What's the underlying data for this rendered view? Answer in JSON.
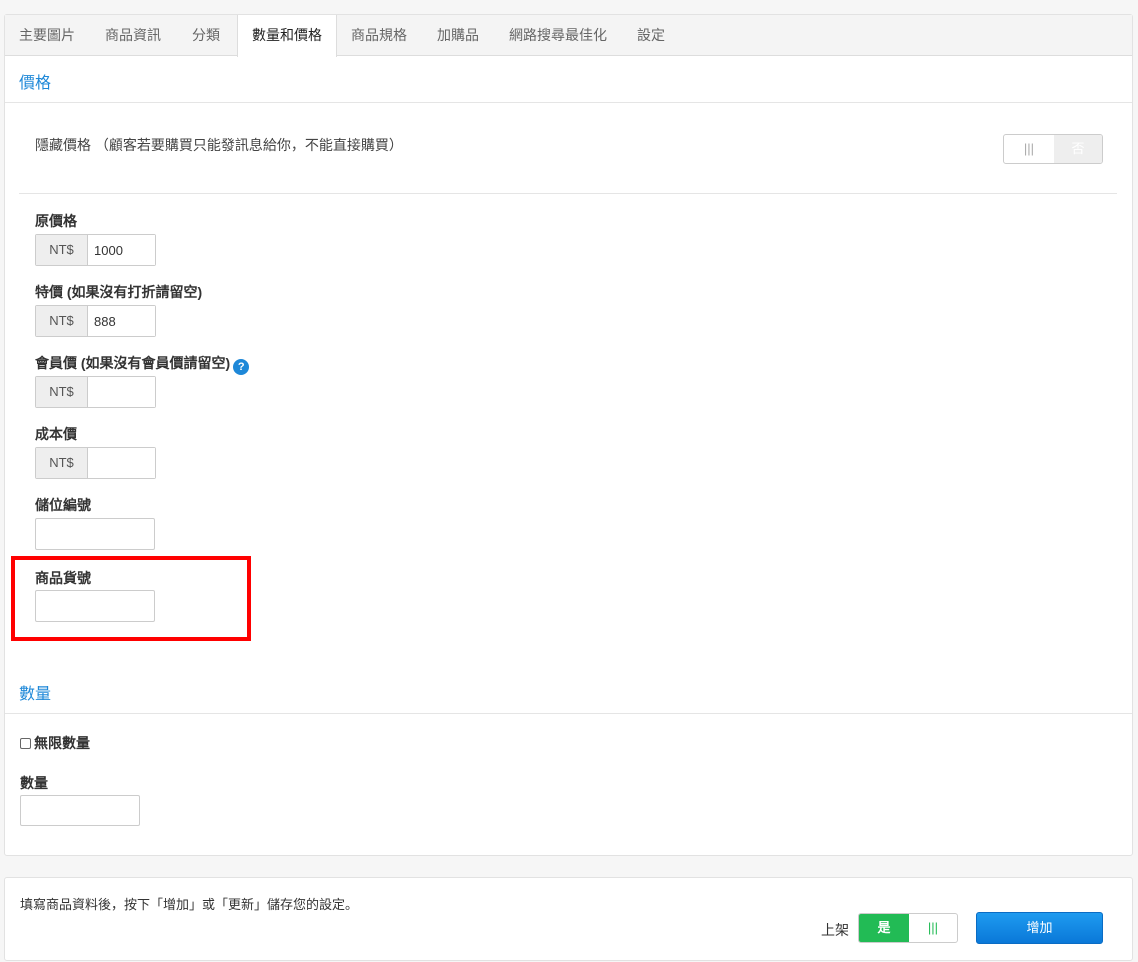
{
  "tabs": [
    {
      "label": "主要圖片"
    },
    {
      "label": "商品資訊"
    },
    {
      "label": "分類"
    },
    {
      "label": "數量和價格"
    },
    {
      "label": "商品規格"
    },
    {
      "label": "加購品"
    },
    {
      "label": "網路搜尋最佳化"
    },
    {
      "label": "設定"
    }
  ],
  "active_tab": "數量和價格",
  "price_section": {
    "title": "價格",
    "hide_price": {
      "label": "隱藏價格 （顧客若要購買只能發訊息給你，不能直接購買）",
      "toggle_on_icon": "|||",
      "toggle_off_label": "否"
    },
    "original_price": {
      "label": "原價格",
      "currency": "NT$",
      "value": "1000"
    },
    "special_price": {
      "label": "特價 (如果沒有打折請留空)",
      "currency": "NT$",
      "value": "888"
    },
    "member_price": {
      "label": "會員價 (如果沒有會員價請留空)",
      "currency": "NT$",
      "value": "",
      "help_icon": "question-circle-icon"
    },
    "cost_price": {
      "label": "成本價",
      "currency": "NT$",
      "value": ""
    },
    "storage_code": {
      "label": "儲位編號",
      "value": ""
    },
    "sku": {
      "label": "商品貨號",
      "value": ""
    }
  },
  "quantity_section": {
    "title": "數量",
    "unlimited_label": "無限數量",
    "unlimited_checked": false,
    "quantity_label": "數量",
    "quantity_value": ""
  },
  "footer": {
    "hint": "填寫商品資料後，按下「增加」或「更新」儲存您的設定。",
    "shelf_label": "上架",
    "shelf_on_label": "是",
    "shelf_toggle_icon": "|||",
    "add_button": "增加"
  },
  "colors": {
    "accent": "#1e88d8",
    "highlight_border": "#ff0000",
    "on_green": "#22bb55",
    "button_blue": "#0a78d8"
  }
}
